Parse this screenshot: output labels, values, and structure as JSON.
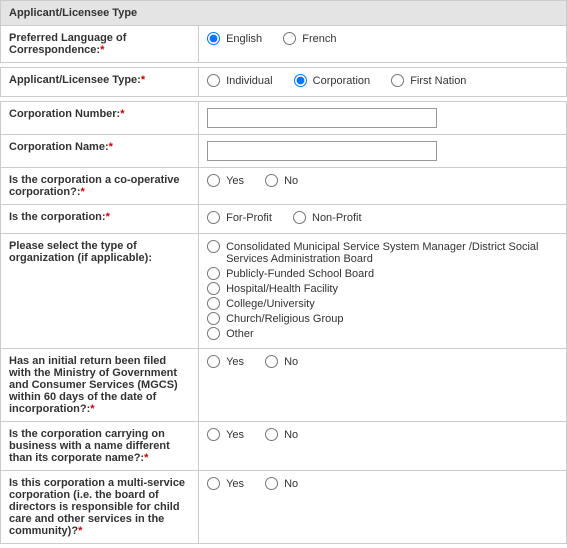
{
  "section_title": "Applicant/Licensee Type",
  "rows": {
    "lang": {
      "label": "Preferred Language of Correspondence:",
      "required": true,
      "english": "English",
      "french": "French",
      "selected": "English"
    },
    "appType": {
      "label": "Applicant/Licensee Type:",
      "required": true,
      "individual": "Individual",
      "corporation": "Corporation",
      "firstNation": "First Nation",
      "selected": "Corporation"
    },
    "corpNumber": {
      "label": "Corporation Number:",
      "required": true,
      "value": ""
    },
    "corpName": {
      "label": "Corporation Name:",
      "required": true,
      "value": ""
    },
    "coop": {
      "label": "Is the corporation a co-operative corporation?:",
      "required": true,
      "yes": "Yes",
      "no": "No"
    },
    "profit": {
      "label": "Is the corporation:",
      "required": true,
      "forProfit": "For-Profit",
      "nonProfit": "Non-Profit"
    },
    "orgType": {
      "label": "Please select the type of organization (if applicable):",
      "required": false,
      "options": [
        "Consolidated Municipal Service System Manager /District Social Services Administration Board",
        "Publicly-Funded School Board",
        "Hospital/Health Facility",
        "College/University",
        "Church/Religious Group",
        "Other"
      ]
    },
    "initialReturn": {
      "label": "Has an initial return been filed with the Ministry of Government and Consumer Services (MGCS) within 60 days of the date of incorporation?:",
      "required": true,
      "yes": "Yes",
      "no": "No"
    },
    "diffName": {
      "label": "Is the corporation carrying on business with a name different than its corporate name?:",
      "required": true,
      "yes": "Yes",
      "no": "No"
    },
    "multiService": {
      "label": "Is this corporation a multi-service corporation (i.e. the board of directors is responsible for child care and other services in the community)?",
      "required": true,
      "yes": "Yes",
      "no": "No"
    }
  }
}
